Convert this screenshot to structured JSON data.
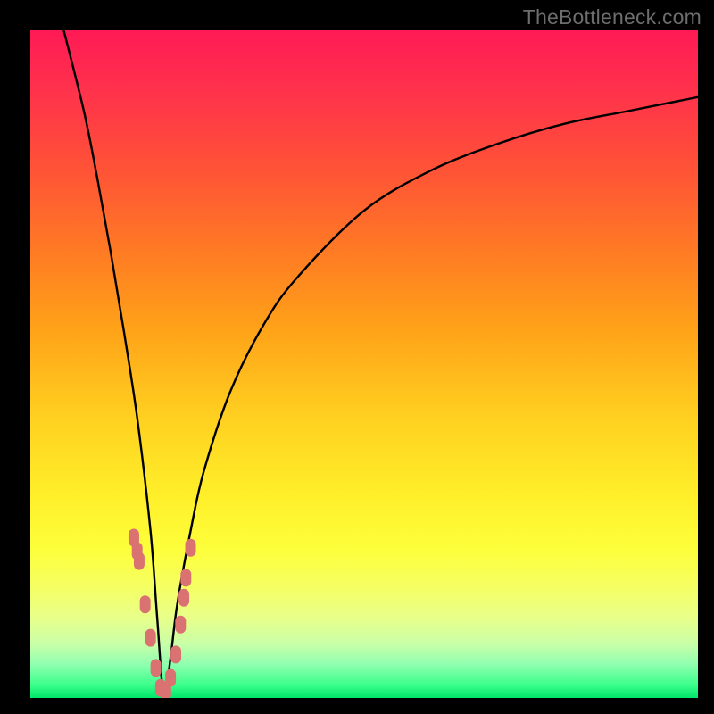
{
  "watermark": "TheBottleneck.com",
  "colors": {
    "frame": "#000000",
    "curve": "#000000",
    "dots": "#da7272",
    "gradient_top": "#ff1a55",
    "gradient_bottom": "#00e76a"
  },
  "chart_data": {
    "type": "line",
    "title": "",
    "xlabel": "",
    "ylabel": "",
    "xlim": [
      0,
      100
    ],
    "ylim": [
      0,
      100
    ],
    "notes": "V-shaped bottleneck curve on vertical heatmap gradient (red=high bottleneck, green=low). Minimum near x≈20 where bottleneck ≈0%.",
    "series": [
      {
        "name": "bottleneck-curve",
        "x": [
          5,
          8,
          10,
          12,
          14,
          16,
          18,
          19,
          20,
          21,
          22,
          24,
          26,
          30,
          35,
          40,
          50,
          60,
          70,
          80,
          90,
          100
        ],
        "values": [
          100,
          88,
          78,
          67,
          55,
          42,
          25,
          12,
          0,
          6,
          14,
          25,
          34,
          46,
          56,
          63,
          73,
          79,
          83,
          86,
          88,
          90
        ]
      }
    ],
    "highlight_points": {
      "name": "sample-dots",
      "x": [
        15.5,
        16.0,
        16.3,
        17.2,
        18.0,
        18.8,
        19.5,
        20.3,
        21.0,
        21.8,
        22.5,
        23.0,
        23.3,
        24.0
      ],
      "values": [
        24.0,
        22.0,
        20.5,
        14.0,
        9.0,
        4.5,
        1.5,
        1.0,
        3.0,
        6.5,
        11.0,
        15.0,
        18.0,
        22.5
      ]
    }
  }
}
